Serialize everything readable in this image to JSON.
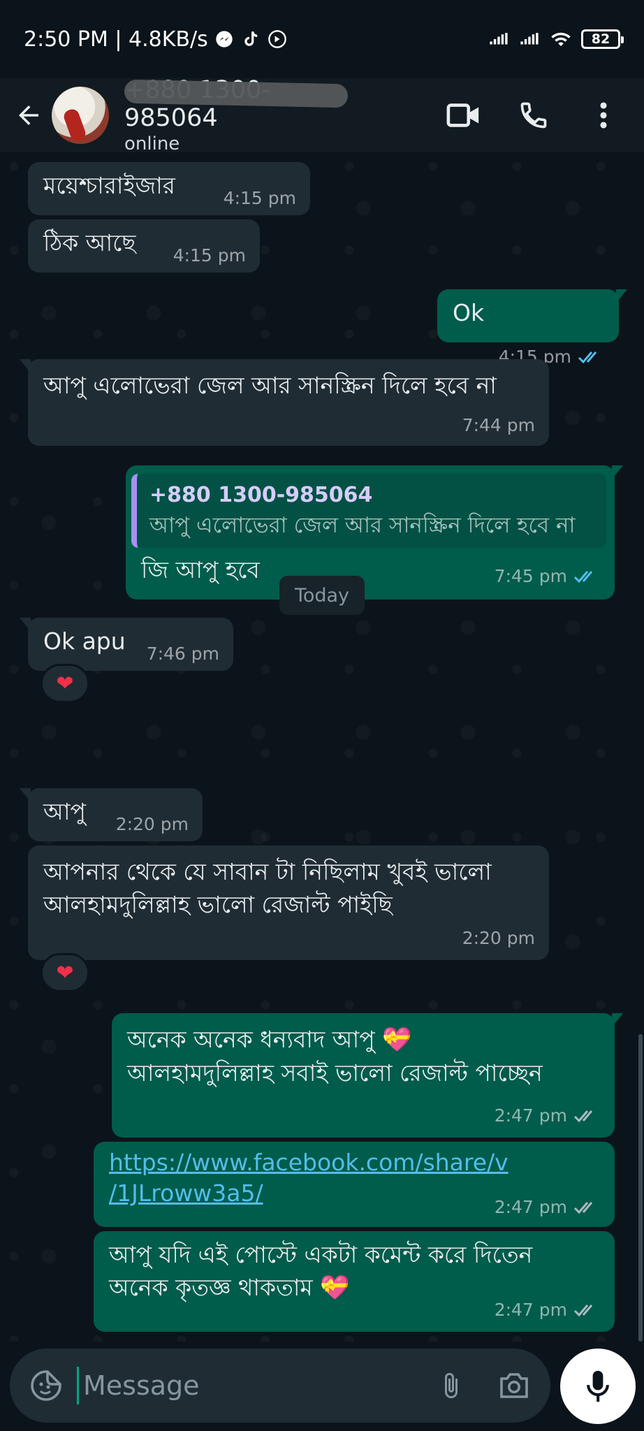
{
  "status_bar": {
    "time_speed": "2:50 PM | 4.8KB/s",
    "battery": "82"
  },
  "header": {
    "contact_name": "+880 1300-985064",
    "contact_status": "online"
  },
  "messages": [
    {
      "text": "ময়েশ্চারাইজার",
      "time": "4:15 pm"
    },
    {
      "text": "ঠিক আছে",
      "time": "4:15 pm"
    },
    {
      "text": "Ok",
      "time": "4:15 pm"
    },
    {
      "text": "আপু এলোভেরা জেল আর সানস্ক্রিন দিলে হবে না",
      "time": "7:44 pm"
    },
    {
      "reply_sender": "+880 1300-985064",
      "reply_text": "আপু এলোভেরা জেল আর সানস্ক্রিন দিলে হবে না",
      "text": "জি আপু হবে",
      "time": "7:45 pm"
    },
    {
      "text": "Ok apu",
      "time": "7:46 pm",
      "reaction": "❤"
    },
    {
      "text": "আপু",
      "time": "2:20 pm"
    },
    {
      "text": "আপনার থেকে যে সাবান টা নিছিলাম খুবই ভালো আলহামদুলিল্লাহ ভালো রেজাল্ট পাইছি",
      "time": "2:20 pm",
      "reaction": "❤"
    },
    {
      "text_line1": "অনেক অনেক ধন্যবাদ আপু",
      "emoji": "💝",
      "text_line2": "আলহামদুলিল্লাহ সবাই ভালো রেজাল্ট পাচ্ছেন",
      "time": "2:47 pm"
    },
    {
      "link_line1": "https://www.facebook.com/share/v",
      "link_line2": "/1JLroww3a5/",
      "time": "2:47 pm"
    },
    {
      "text_line1": "আপু যদি এই পোস্টে একটা কমেন্ট করে দিতেন",
      "text_line2": "অনেক কৃতজ্ঞ থাকতাম",
      "emoji": "💝",
      "time": "2:47 pm"
    }
  ],
  "date_chip": "Today",
  "composer": {
    "placeholder": "Message"
  },
  "colors": {
    "background": "#0b141a",
    "incoming_bubble": "#202c33",
    "outgoing_bubble": "#005c4b",
    "read_tick": "#53bdeb",
    "link": "#53bdeb"
  }
}
